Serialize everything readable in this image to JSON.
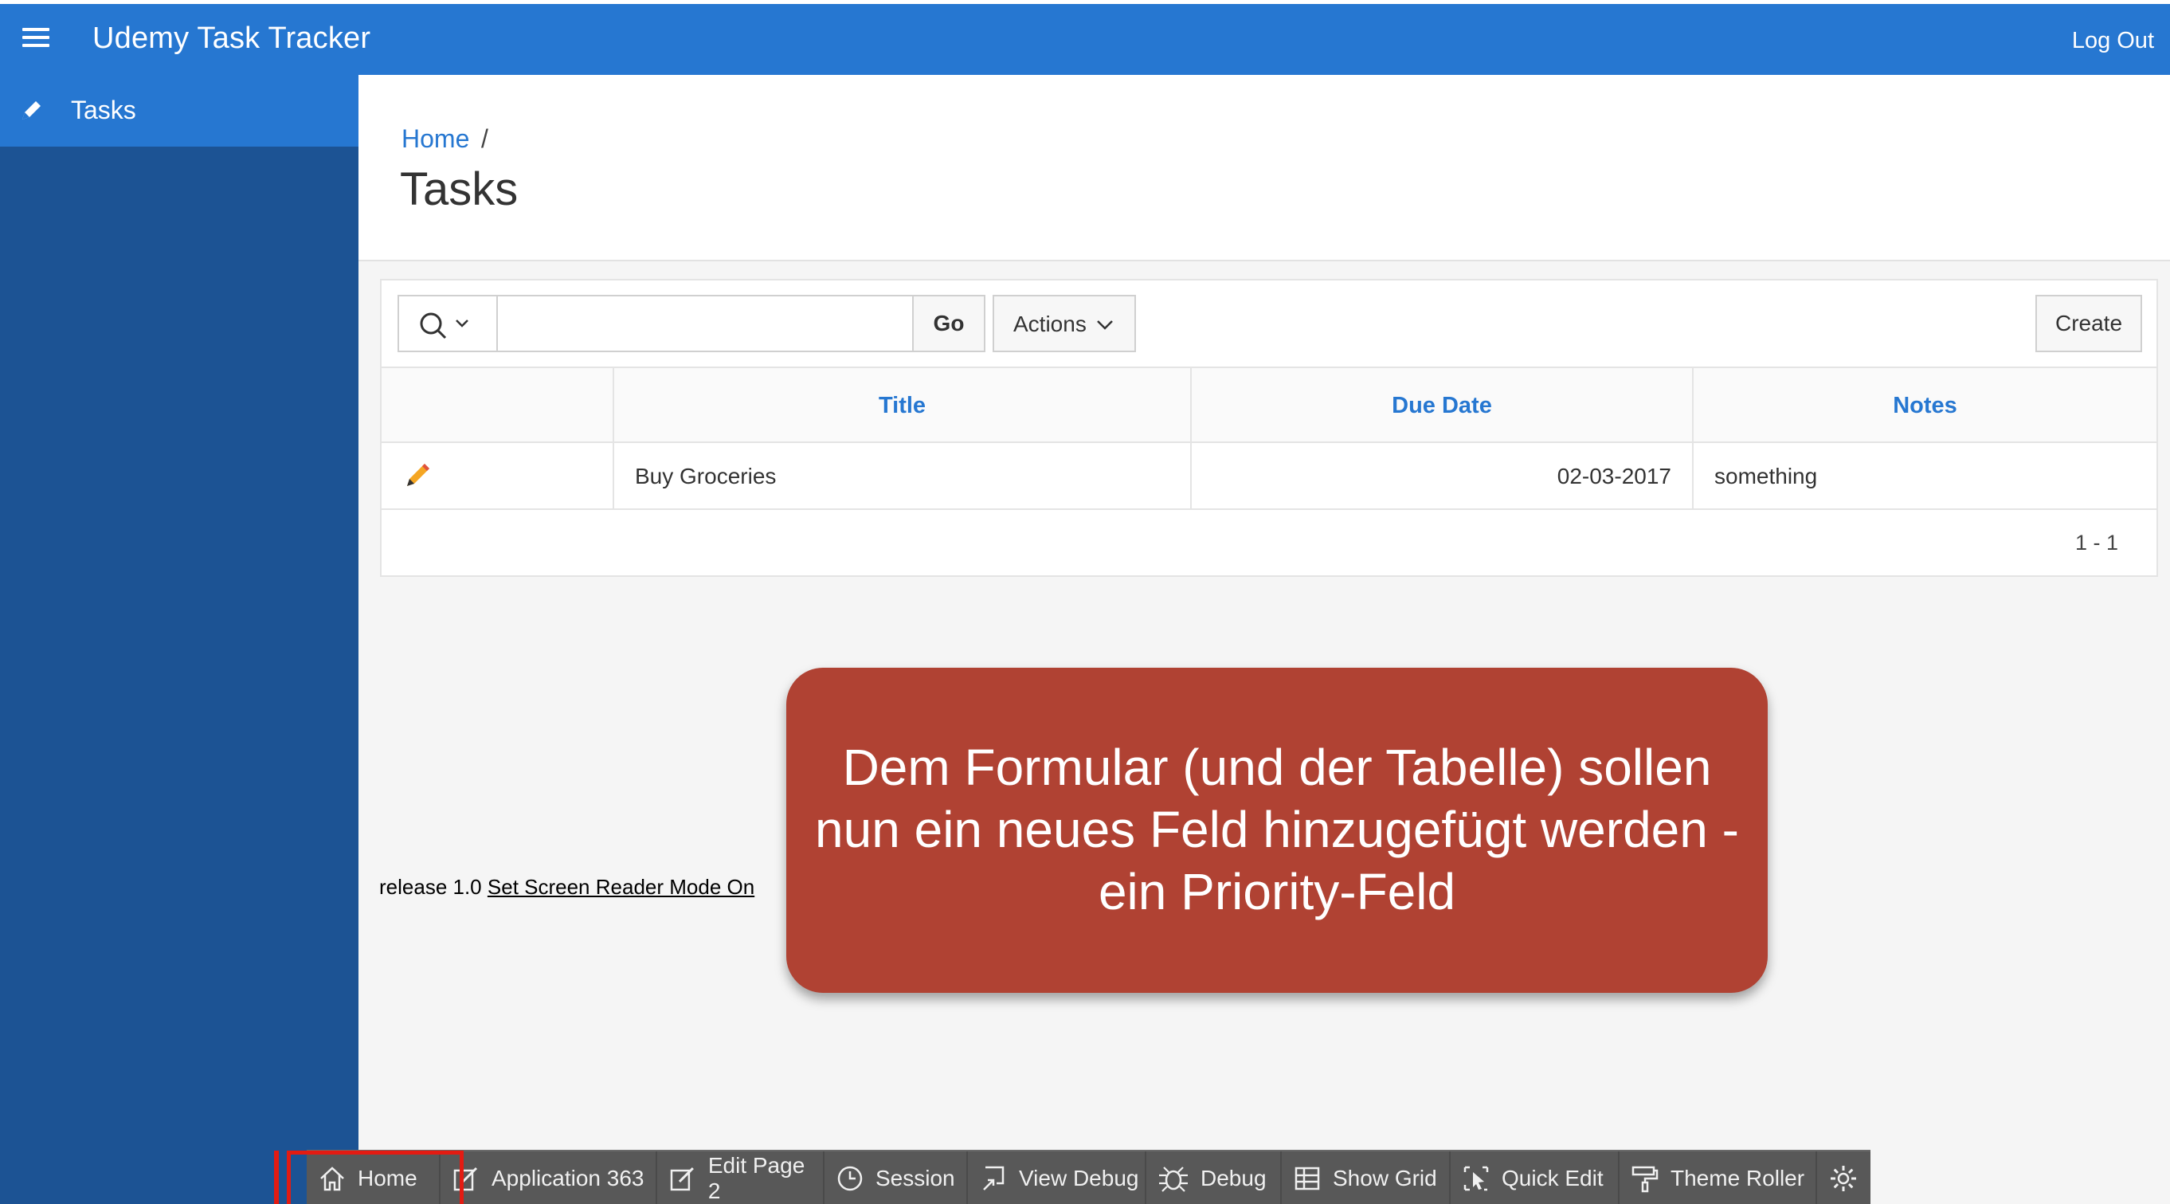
{
  "header": {
    "app_title": "Udemy Task Tracker",
    "logout_label": "Log Out",
    "brand_color": "#2677d1"
  },
  "sidebar": {
    "items": [
      {
        "label": "Tasks",
        "icon": "pencil-icon"
      }
    ],
    "bg_color": "#1c5394"
  },
  "breadcrumb": {
    "home": "Home",
    "separator": "/"
  },
  "page": {
    "title": "Tasks"
  },
  "toolbar": {
    "search_value": "",
    "go_label": "Go",
    "actions_label": "Actions",
    "create_label": "Create"
  },
  "table": {
    "columns": [
      "Title",
      "Due Date",
      "Notes"
    ],
    "rows": [
      {
        "title": "Buy Groceries",
        "due_date": "02-03-2017",
        "notes": "something"
      }
    ],
    "pagination": "1 - 1"
  },
  "footer": {
    "release_text": "release 1.0",
    "screen_reader_link": "Set Screen Reader Mode On"
  },
  "callout": {
    "lines": [
      "Dem Formular (und der Tabelle) sollen",
      "nun ein neues Feld hinzugefügt werden -",
      "ein Priority-Feld"
    ],
    "color": "#b04233"
  },
  "devbar": {
    "items": [
      "Home",
      "Application 363",
      "Edit Page 2",
      "Session",
      "View Debug",
      "Debug",
      "Show Grid",
      "Quick Edit",
      "Theme Roller"
    ]
  }
}
